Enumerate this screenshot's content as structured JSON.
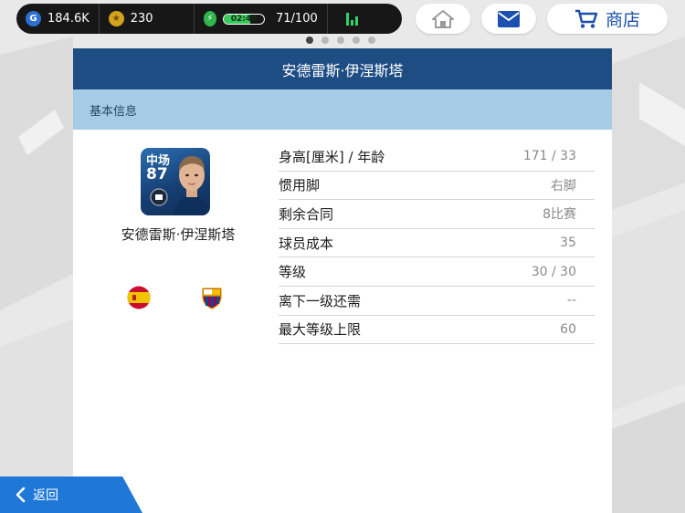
{
  "hud": {
    "gp_value": "184.6K",
    "gp_icon": "G",
    "coins_value": "230",
    "energy_timer": "02:48",
    "energy_level": 0.65,
    "energy_count": "71/100"
  },
  "top_buttons": {
    "home_icon": "home-icon",
    "mail_icon": "mail-icon",
    "shop_label": "商店"
  },
  "pagination": {
    "total": 5,
    "active_index": 0
  },
  "panel": {
    "title": "安德雷斯·伊涅斯塔",
    "section_label": "基本信息"
  },
  "player": {
    "position": "中场",
    "rating": "87",
    "name": "安德雷斯·伊涅斯塔",
    "nationality_flag": "spain-flag",
    "club_badge": "barcelona-badge"
  },
  "stats": [
    {
      "label": "身高[厘米] / 年龄",
      "value": "171 / 33"
    },
    {
      "label": "惯用脚",
      "value": "右脚"
    },
    {
      "label": "剩余合同",
      "value": "8比赛"
    },
    {
      "label": "球员成本",
      "value": "35"
    },
    {
      "label": "等级",
      "value": "30 / 30"
    },
    {
      "label": "离下一级还需",
      "value": "--"
    },
    {
      "label": "最大等级上限",
      "value": "60"
    }
  ],
  "back_button": {
    "label": "返回"
  },
  "colors": {
    "header_bg": "#1e4d84",
    "section_bg": "#a6cbe5",
    "accent_blue": "#1f78d8",
    "shop_text": "#1d4fae"
  }
}
